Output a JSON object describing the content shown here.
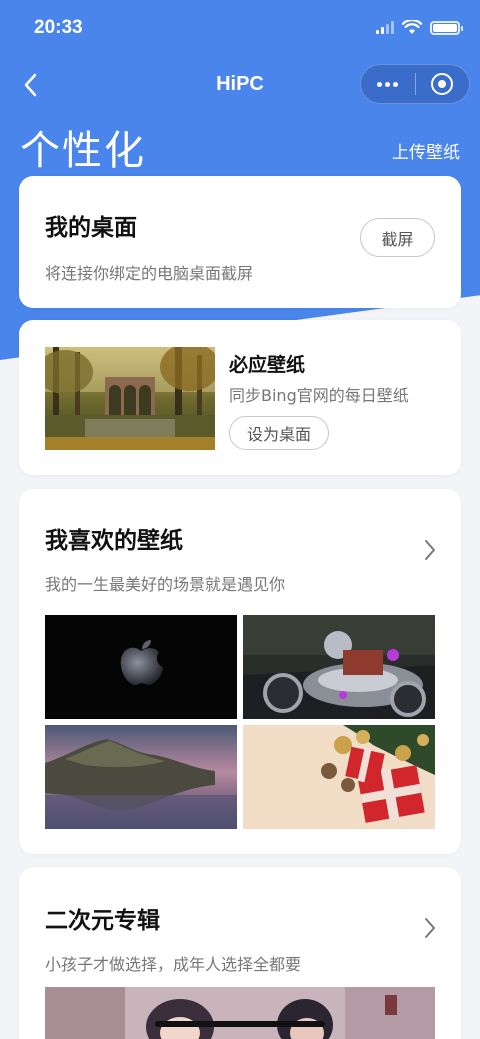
{
  "status": {
    "time": "20:33"
  },
  "nav": {
    "title": "HiPC"
  },
  "page": {
    "title": "个性化",
    "upload_label": "上传壁纸"
  },
  "desktop_card": {
    "title": "我的桌面",
    "subtitle": "将连接你绑定的电脑桌面截屏",
    "button": "截屏"
  },
  "bing_card": {
    "title": "必应壁纸",
    "subtitle": "同步Bing官网的每日壁纸",
    "button": "设为桌面"
  },
  "favorites_card": {
    "title": "我喜欢的壁纸",
    "subtitle": "我的一生最美好的场景就是遇见你",
    "images": [
      "apple-logo-wallpaper",
      "motorcycle-rider-wallpaper",
      "island-sunset-wallpaper",
      "christmas-gift-wallpaper"
    ]
  },
  "anime_card": {
    "title": "二次元专辑",
    "subtitle": "小孩子才做选择，成年人选择全都要"
  },
  "colors": {
    "brand_blue": "#4a85ec",
    "background": "#f3f4f8"
  }
}
